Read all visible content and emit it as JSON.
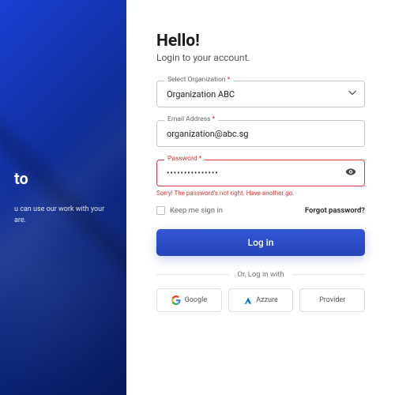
{
  "hero": {
    "title_suffix": "to",
    "body": "u can use our work with your are."
  },
  "form": {
    "greeting": "Hello!",
    "subtitle": "Login to your account.",
    "org": {
      "label": "Select Organization",
      "value": "Organization ABC"
    },
    "email": {
      "label": "Email Address",
      "value": "organization@abc.sg"
    },
    "password": {
      "label": "Password",
      "value": "•••••••••••••••",
      "error": "Sorry! The password's not right. Have another go."
    },
    "keep_label": "Keep me sign in",
    "forgot_label": "Forgot password?",
    "submit_label": "Log in"
  },
  "alt": {
    "divider_text": "Or, Log in with",
    "providers": {
      "google": "Google",
      "azure": "Azzure",
      "provider": "Provider"
    }
  }
}
